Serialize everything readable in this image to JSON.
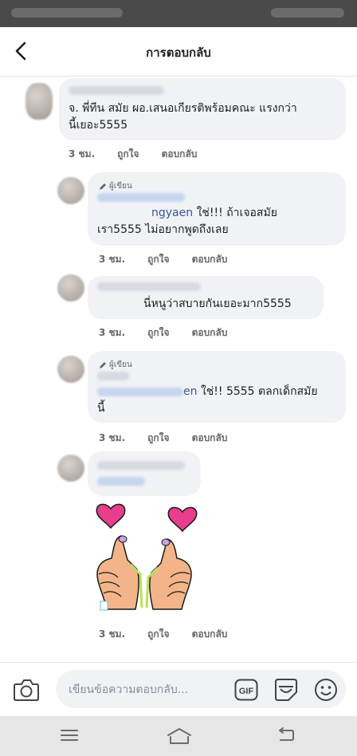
{
  "header": {
    "title": "การตอบกลับ",
    "back_icon": "chevron-left-icon"
  },
  "comments": [
    {
      "name_prefix": "จ.",
      "text": "พี่ทีน สมัย ผอ.เสนอเกียรติพร้อมคณะ แรงกว่า",
      "text_line2": "นี้เยอะ5555",
      "time": "3 ชม.",
      "like": "ถูกใจ",
      "reply": "ตอบกลับ"
    },
    {
      "author_tag": "ผู้เขียน",
      "mention_visible": "ngyaen",
      "text": " ใช่!!! ถ้าเจอสมัย",
      "text_line2": "เรา5555 ไม่อยากพูดถึงเลย",
      "time": "3 ชม.",
      "like": "ถูกใจ",
      "reply": "ตอบกลับ"
    },
    {
      "text": "นี่หนูว่าสบายกันเยอะมาก5555",
      "time": "3 ชม.",
      "like": "ถูกใจ",
      "reply": "ตอบกลับ"
    },
    {
      "author_tag": "ผู้เขียน",
      "mention_visible": "en",
      "text": " ใช่!! 5555 ตลกเด็กสมัย",
      "text_line2": "นี้",
      "time": "3 ชม.",
      "like": "ถูกใจ",
      "reply": "ตอบกลับ"
    },
    {
      "sticker": "heart-hands-sticker",
      "time": "3 ชม.",
      "like": "ถูกใจ",
      "reply": "ตอบกลับ"
    }
  ],
  "compose": {
    "placeholder": "เขียนข้อความตอบกลับ...",
    "gif_label": "GIF"
  },
  "colors": {
    "bubble": "#f0f2f5",
    "mention": "#385898",
    "muted": "#65676b"
  }
}
